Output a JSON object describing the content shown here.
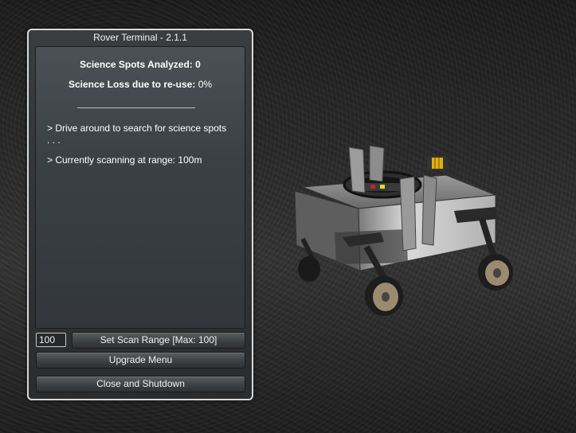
{
  "window": {
    "title": "Rover Terminal - 2.1.1"
  },
  "stats": {
    "spots_label": "Science Spots Analyzed:",
    "spots_value": "0",
    "loss_label": "Science Loss due to re-use:",
    "loss_value": "0%",
    "divider": "____________________"
  },
  "messages": [
    "> Drive around to search for science spots . . .",
    "> Currently scanning at range: 100m"
  ],
  "controls": {
    "range_value": "100",
    "set_range_label": "Set Scan Range [Max: 100]",
    "upgrade_label": "Upgrade Menu",
    "close_label": "Close and Shutdown"
  },
  "colors": {
    "border": "#d8d8d8",
    "text": "#ffffff",
    "scene_bg": "#262626"
  }
}
